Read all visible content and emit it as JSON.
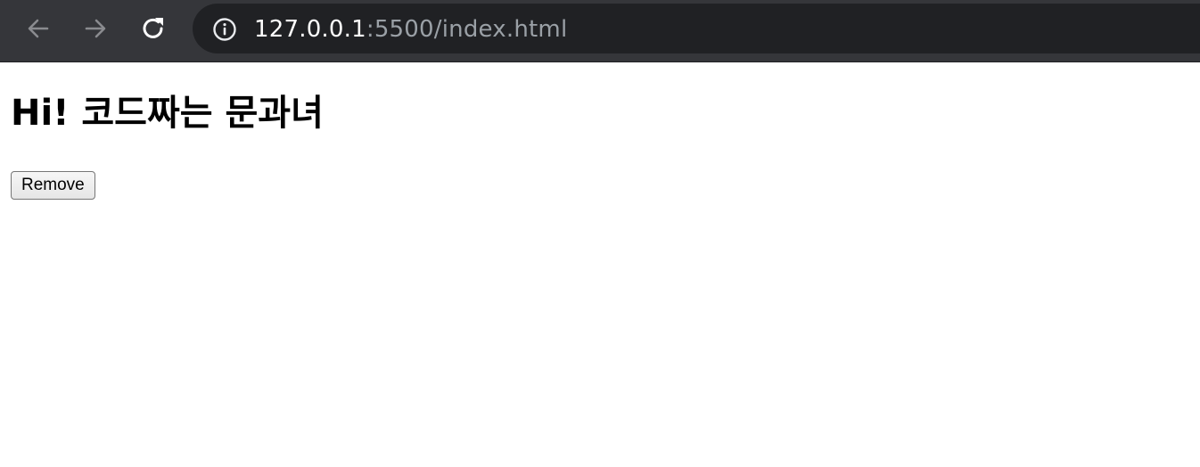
{
  "browser": {
    "url_host": "127.0.0.1",
    "url_rest": ":5500/index.html",
    "toolbar_color": "#35363a",
    "omnibox_color": "#202124",
    "icons": {
      "back": "arrow-left-icon",
      "forward": "arrow-right-icon",
      "reload": "reload-icon",
      "site_info": "info-circle-icon"
    }
  },
  "page": {
    "heading": "Hi! 코드짜는 문과녀",
    "remove_button_label": "Remove"
  }
}
